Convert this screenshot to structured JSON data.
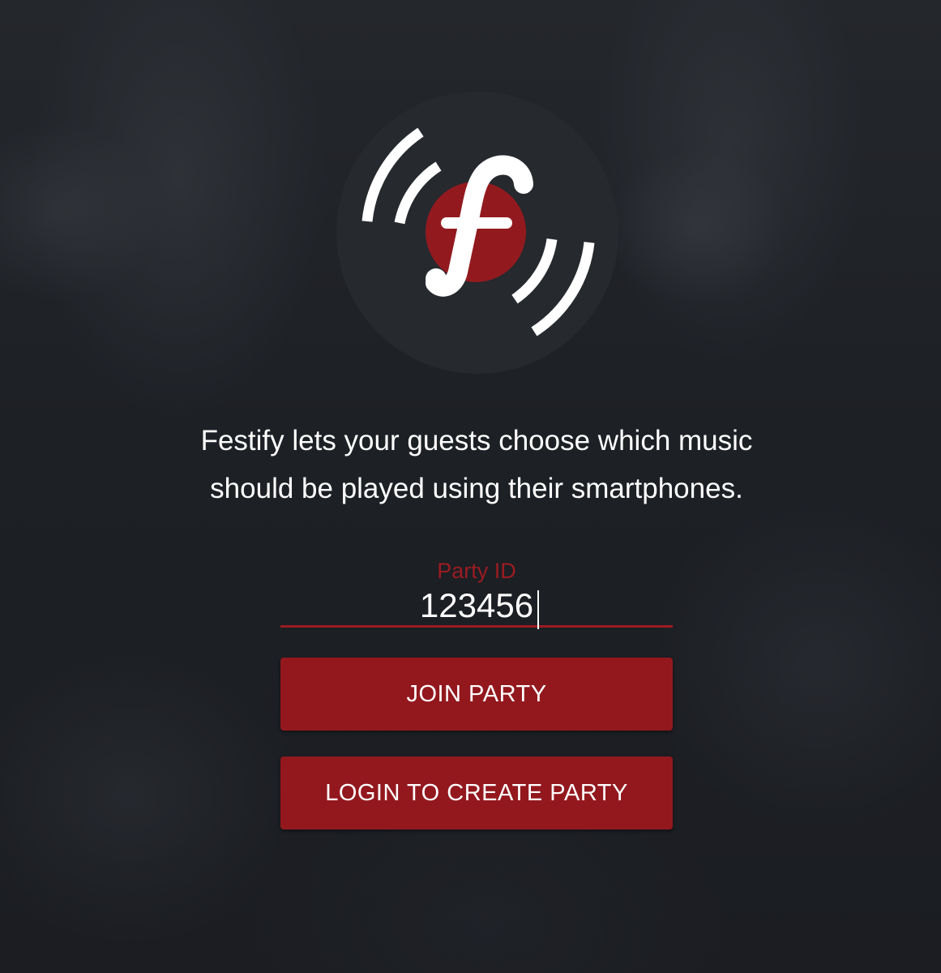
{
  "app": {
    "logo_icon": "festify-logo-icon",
    "tagline_line1": "Festify lets your guests choose which music",
    "tagline_line2": "should be played using their smartphones."
  },
  "form": {
    "party_id_label": "Party ID",
    "party_id_value": "123456",
    "join_label": "JOIN PARTY",
    "login_label": "LOGIN TO CREATE PARTY"
  },
  "colors": {
    "accent": "#93181e",
    "label": "#9a1c22",
    "background": "#1c1e23",
    "disc": "#26292e",
    "text": "#ffffff"
  }
}
